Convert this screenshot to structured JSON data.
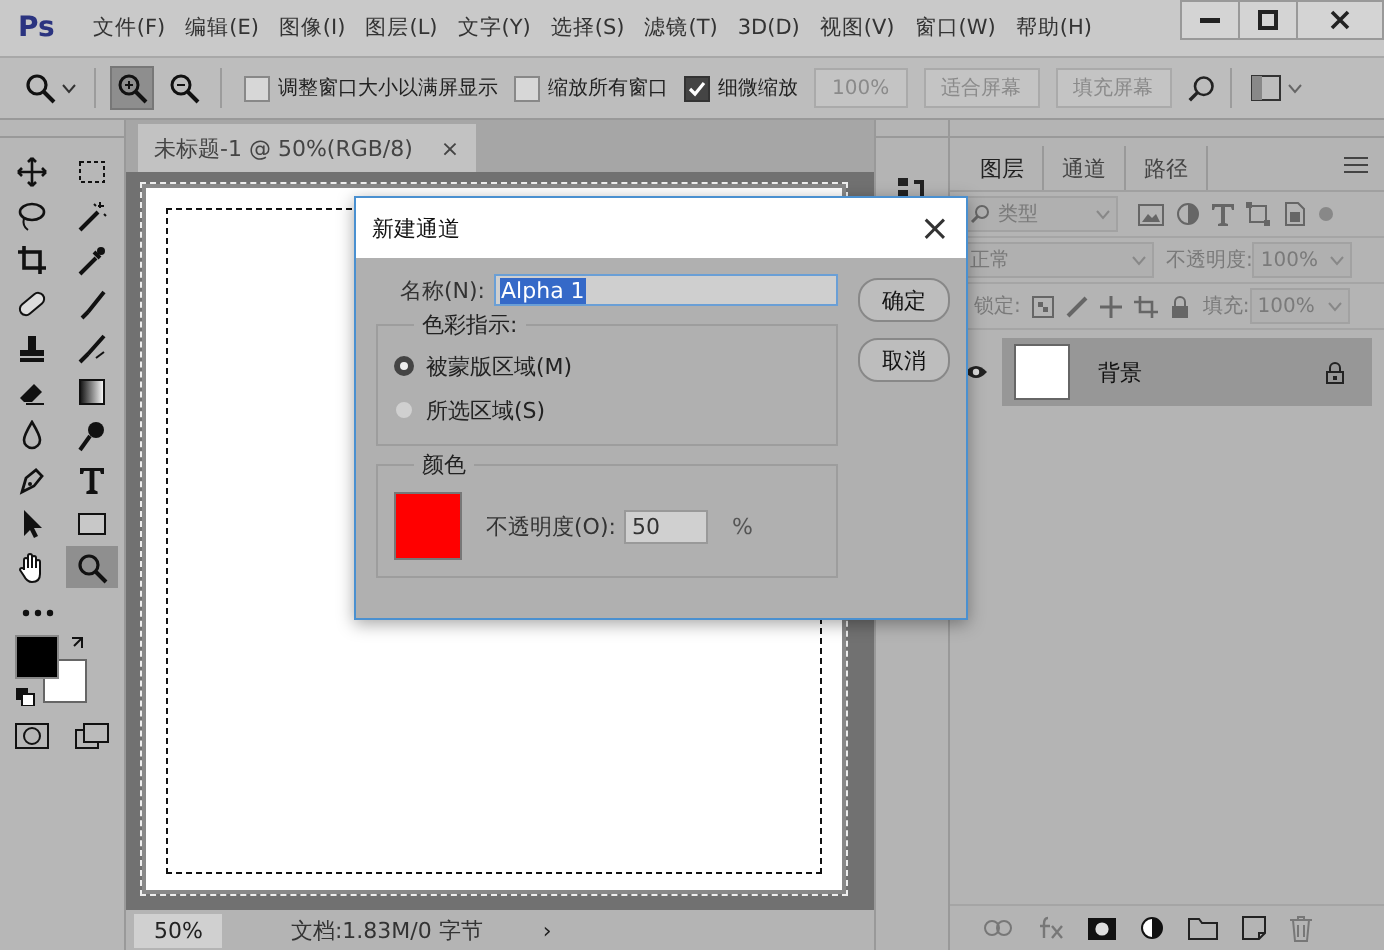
{
  "app": {
    "logo": "Ps"
  },
  "menu": [
    "文件(F)",
    "编辑(E)",
    "图像(I)",
    "图层(L)",
    "文字(Y)",
    "选择(S)",
    "滤镜(T)",
    "3D(D)",
    "视图(V)",
    "窗口(W)",
    "帮助(H)"
  ],
  "options": {
    "zoom_in_selected": true,
    "zoom_out_selected": false,
    "checkboxes": [
      {
        "label": "调整窗口大小以满屏显示",
        "checked": false
      },
      {
        "label": "缩放所有窗口",
        "checked": false
      },
      {
        "label": "细微缩放",
        "checked": true
      }
    ],
    "buttons": [
      {
        "label": "100%",
        "disabled": true
      },
      {
        "label": "适合屏幕",
        "disabled": true
      },
      {
        "label": "填充屏幕",
        "disabled": true
      }
    ]
  },
  "tools": [
    {
      "selected": false
    },
    {
      "selected": false
    },
    {
      "selected": false
    },
    {
      "selected": false
    },
    {
      "selected": false
    },
    {
      "selected": false
    },
    {
      "selected": false
    },
    {
      "selected": false
    },
    {
      "selected": false
    },
    {
      "selected": false
    },
    {
      "selected": false
    },
    {
      "selected": false
    },
    {
      "selected": false
    },
    {
      "selected": false
    },
    {
      "selected": false
    },
    {
      "selected": false
    },
    {
      "selected": false
    },
    {
      "selected": false
    },
    {
      "selected": false
    },
    {
      "selected": true
    }
  ],
  "document": {
    "tab": "未标题-1 @ 50%(RGB/8)",
    "close": "×",
    "zoom": "50%",
    "info": "文档:1.83M/0 字节",
    "more": "›"
  },
  "layers_panel": {
    "tabs": [
      {
        "label": "图层",
        "selected": true
      },
      {
        "label": "通道",
        "selected": false
      },
      {
        "label": "路径",
        "selected": false
      }
    ],
    "filter": "类型",
    "blend_mode": "正常",
    "opacity_label": "不透明度:",
    "opacity": "100%",
    "lock_label": "锁定:",
    "fill_label": "填充:",
    "fill": "100%",
    "layers": [
      {
        "name": "背景",
        "visible": true,
        "locked": true,
        "selected": true
      }
    ]
  },
  "dialog": {
    "title": "新建通道",
    "close": "×",
    "name_label": "名称(N):",
    "name_value": "Alpha 1",
    "indicator_legend": "色彩指示:",
    "radios": [
      {
        "label": "被蒙版区域(M)",
        "selected": true
      },
      {
        "label": "所选区域(S)",
        "selected": false
      }
    ],
    "color_legend": "颜色",
    "color": "#ff0000",
    "opacity_label": "不透明度(O):",
    "opacity": "50",
    "unit": "%",
    "buttons": [
      "确定",
      "取消"
    ]
  }
}
